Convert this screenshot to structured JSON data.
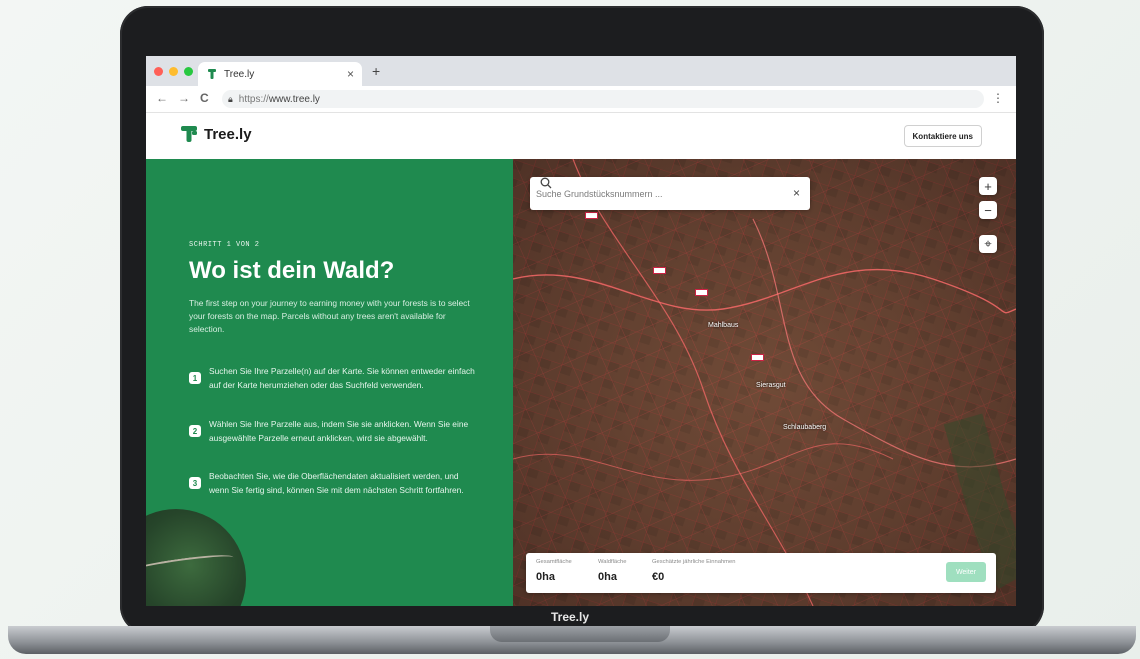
{
  "browser": {
    "tab_title": "Tree.ly",
    "tab_close": "×",
    "new_tab": "+",
    "back": "←",
    "forward": "→",
    "reload": "C",
    "url_scheme": "https://",
    "url_host": "www.tree.ly",
    "menu": "⋮"
  },
  "header": {
    "logo_text": "Tree.ly",
    "contact_button": "Kontaktiere uns"
  },
  "panel": {
    "step_label": "SCHRITT 1 VON 2",
    "title": "Wo ist dein Wald?",
    "description": "The first step on your journey to earning money with your forests is to select your forests on the map. Parcels without any trees aren't available for selection.",
    "steps": [
      {
        "num": "1",
        "text": "Suchen Sie Ihre Parzelle(n) auf der Karte. Sie können entweder einfach auf der Karte herumziehen oder das Suchfeld verwenden."
      },
      {
        "num": "2",
        "text": "Wählen Sie Ihre Parzelle aus, indem Sie sie anklicken. Wenn Sie eine ausgewählte Parzelle erneut anklicken, wird sie abgewählt."
      },
      {
        "num": "3",
        "text": "Beobachten Sie, wie die Oberflächendaten aktualisiert werden, und wenn Sie fertig sind, können Sie mit dem nächsten Schritt fortfahren."
      }
    ]
  },
  "map": {
    "search_placeholder": "Suche Grundstücksnummern ...",
    "search_clear": "×",
    "zoom_in": "+",
    "zoom_out": "−",
    "locate": "⌖",
    "labels": [
      "Mahlbaus",
      "Sierasgut",
      "Schlaubaberg"
    ]
  },
  "summary": {
    "total_label": "Gesamtfläche",
    "total_value": "0ha",
    "forest_label": "Waldfläche",
    "forest_value": "0ha",
    "income_label": "Geschätzte jährliche Einnahmen",
    "income_value": "€0",
    "next_button": "Weiter"
  },
  "device": {
    "bezel_label": "Tree.ly"
  },
  "colors": {
    "brand_green": "#1f8a4f",
    "button_disabled": "#9fdfbf",
    "parcel_lines": "#d8383a"
  }
}
